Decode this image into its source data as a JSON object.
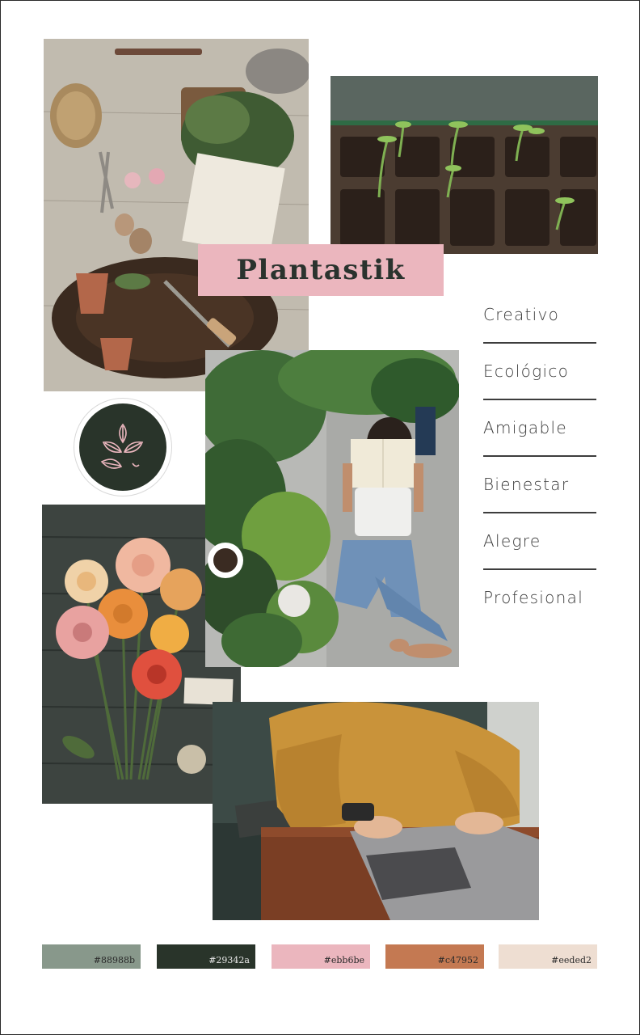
{
  "brand": {
    "name": "Plantastik"
  },
  "keywords": [
    {
      "label": "Creativo"
    },
    {
      "label": "Ecológico"
    },
    {
      "label": "Amigable"
    },
    {
      "label": "Bienestar"
    },
    {
      "label": "Alegre"
    },
    {
      "label": "Profesional"
    }
  ],
  "palette": [
    {
      "hex": "#88988b",
      "label": "#88988b"
    },
    {
      "hex": "#29342a",
      "label": "#29342a"
    },
    {
      "hex": "#ebb6be",
      "label": "#ebb6be"
    },
    {
      "hex": "#c47952",
      "label": "#c47952"
    },
    {
      "hex": "#eeded2",
      "label": "#eeded2"
    }
  ],
  "photos": [
    {
      "subject": "gardening-tools-on-soil"
    },
    {
      "subject": "seedling-tray"
    },
    {
      "subject": "woman-reading-among-plants"
    },
    {
      "subject": "dahlia-bouquet"
    },
    {
      "subject": "person-typing-laptop"
    }
  ]
}
